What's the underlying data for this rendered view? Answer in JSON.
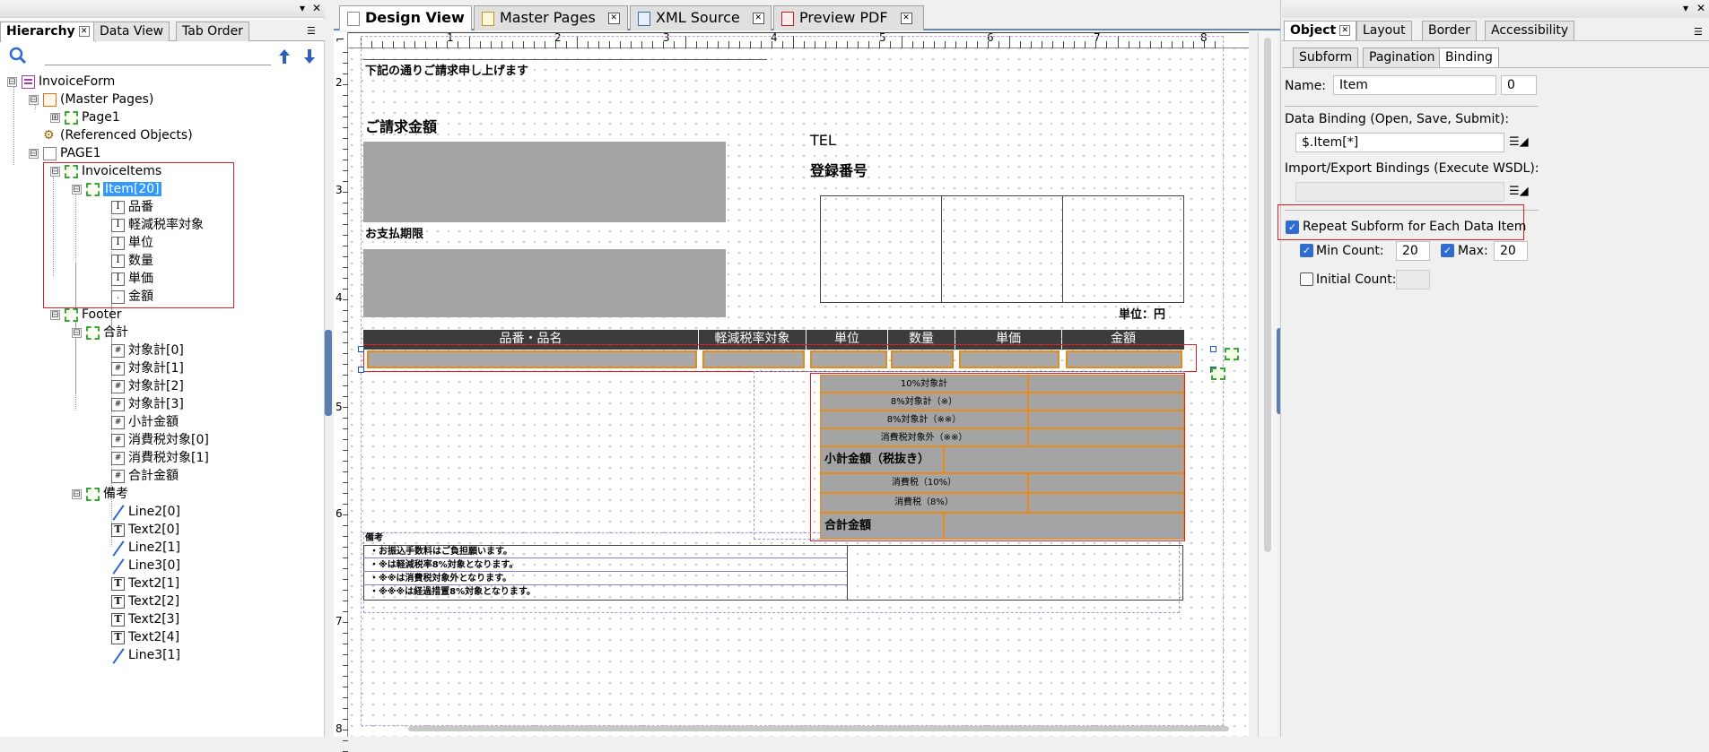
{
  "left_panel": {
    "tabs": [
      "Hierarchy",
      "Data View",
      "Tab Order"
    ],
    "tree": {
      "root": "InvoiceForm",
      "master_pages": "(Master Pages)",
      "page1": "Page1",
      "referenced_objects": "(Referenced Objects)",
      "page_upper": "PAGE1",
      "invoice_items": "InvoiceItems",
      "item": "Item[20]",
      "item_fields": [
        "品番",
        "軽減税率対象",
        "単位",
        "数量",
        "単価",
        "金額"
      ],
      "footer": "Footer",
      "total_group": "合計",
      "total_fields": [
        "対象計[0]",
        "対象計[1]",
        "対象計[2]",
        "対象計[3]",
        "小計金額",
        "消費税対象[0]",
        "消費税対象[1]",
        "合計金額"
      ],
      "remarks_group": "備考",
      "remarks_fields": [
        "Line2[0]",
        "Text2[0]",
        "Line2[1]",
        "Line3[0]",
        "Text2[1]",
        "Text2[2]",
        "Text2[3]",
        "Text2[4]",
        "Line3[1]"
      ]
    }
  },
  "doc_tabs": [
    "Design View",
    "Master Pages",
    "XML Source",
    "Preview PDF"
  ],
  "ruler": {
    "h_numbers": [
      "1",
      "2",
      "3",
      "4",
      "5",
      "6",
      "7",
      "8"
    ],
    "v_numbers": [
      "2",
      "3",
      "4",
      "5",
      "6",
      "7",
      "8"
    ]
  },
  "form": {
    "intro": "下記の通りご請求申し上げます",
    "billing_amount": "ご請求金額",
    "tel": "TEL",
    "registration_number": "登録番号",
    "due_date": "お支払期限",
    "unit_yen": "単位：円",
    "table_headers": [
      "品番・品名",
      "軽減税率対象",
      "単位",
      "数量",
      "単価",
      "金額"
    ],
    "summary_rows": [
      "10%対象計",
      "8%対象計（※）",
      "8%対象計（※※）",
      "消費税対象外（※※）"
    ],
    "subtotal": "小計金額（税抜き）",
    "tax_rows": [
      "消費税（10%）",
      "消費税（8%）"
    ],
    "grand_total": "合計金額",
    "remarks_title": "備考",
    "remarks_lines": [
      "・お振込手数料はご負担願います。",
      "・※は軽減税率8%対象となります。",
      "・※※は消費税対象外となります。",
      "・※※※は経過措置8%対象となります。"
    ]
  },
  "right_panel": {
    "tabs": [
      "Object",
      "Layout",
      "Border",
      "Accessibility"
    ],
    "subtabs": [
      "Subform",
      "Pagination",
      "Binding"
    ],
    "name_label": "Name:",
    "name_value": "Item",
    "index_value": "0",
    "data_binding_label": "Data Binding (Open, Save, Submit):",
    "data_binding_value": "$.Item[*]",
    "import_export_label": "Import/Export Bindings (Execute WSDL):",
    "repeat_label": "Repeat Subform for Each Data Item",
    "repeat_checked": true,
    "min_label": "Min Count:",
    "min_value": "20",
    "min_checked": true,
    "max_label": "Max:",
    "max_value": "20",
    "max_checked": true,
    "initial_label": "Initial Count:",
    "initial_checked": false
  },
  "colors": {
    "selection": "#3399ff",
    "highlight_box": "#e02020",
    "field_border": "#e88a1a",
    "header_fill": "#3c3c3c",
    "field_fill": "#a4a4a4"
  }
}
